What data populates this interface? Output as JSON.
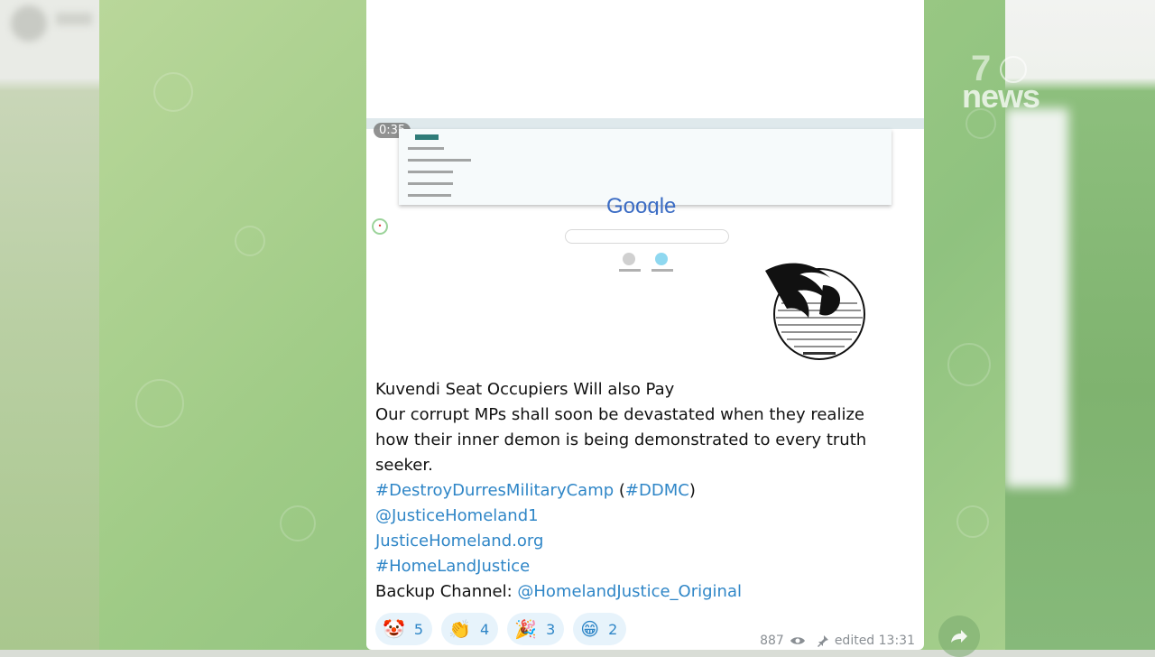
{
  "overlay": {
    "logo_number": "7",
    "logo_text": "news"
  },
  "media": {
    "duration": "0:35",
    "google_text": "Google"
  },
  "caption": {
    "title": "Kuvendi Seat Occupiers Will also Pay",
    "body_line1": "Our corrupt MPs shall soon be devastated when they realize",
    "body_line2": "how their inner demon is being demonstrated to every truth",
    "body_line3": "seeker.",
    "hashtag_main": "#DestroyDurresMilitaryCamp",
    "paren_open": " (",
    "hashtag_short": "#DDMC",
    "paren_close": ")",
    "mention": "@JusticeHomeland1",
    "website": "JusticeHomeland.org",
    "hashtag_justice": "#HomeLandJustice",
    "backup_label": "Backup Channel: ",
    "backup_link": "@HomelandJustice_Original"
  },
  "reactions": [
    {
      "emoji": "🤡",
      "icon": "clown-face-icon",
      "count": "5"
    },
    {
      "emoji": "👏",
      "icon": "clapping-hands-icon",
      "count": "4"
    },
    {
      "emoji": "🎉",
      "icon": "party-popper-icon",
      "count": "3"
    },
    {
      "emoji": "😁",
      "icon": "grinning-face-icon",
      "count": "2"
    }
  ],
  "meta": {
    "views": "887",
    "edited_label": "edited 13:31"
  },
  "colors": {
    "link": "#2f86c7",
    "reaction_bg": "#e7f3fb",
    "wallpaper": "#9fcb86"
  }
}
